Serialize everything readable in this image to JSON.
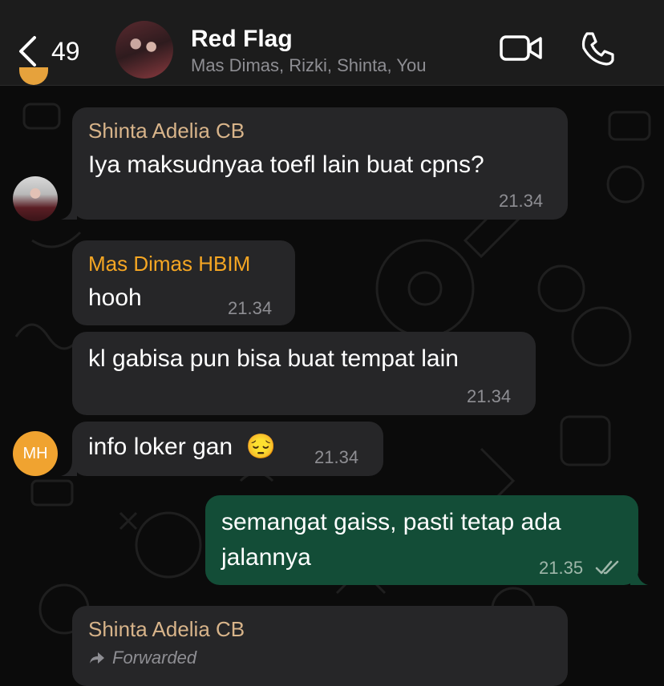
{
  "header": {
    "back_count": "49",
    "title": "Red Flag",
    "members": "Mas Dimas, Rizki, Shinta, You"
  },
  "colors": {
    "incoming_bubble": "#262628",
    "outgoing_bubble": "#134d37",
    "shinta_name": "#d8b48a",
    "dimas_name": "#f5a623",
    "mh_avatar": "#f0a330"
  },
  "messages": [
    {
      "sender": "Shinta Adelia CB",
      "text": "Iya maksudnyaa toefl lain buat cpns?",
      "time": "21.34"
    },
    {
      "sender": "Mas Dimas HBIM",
      "text": "hooh",
      "time": "21.34"
    },
    {
      "text": "kl gabisa pun bisa buat tempat lain",
      "time": "21.34"
    },
    {
      "text": "info loker gan",
      "emoji": "😔",
      "time": "21.34"
    },
    {
      "text_line1": "semangat gaiss, pasti tetap ada",
      "text_line2": "jalannya",
      "time": "21.35",
      "status": "read"
    },
    {
      "sender": "Shinta Adelia CB",
      "forwarded_label": "Forwarded"
    }
  ],
  "avatars": {
    "mh_initials": "MH"
  }
}
